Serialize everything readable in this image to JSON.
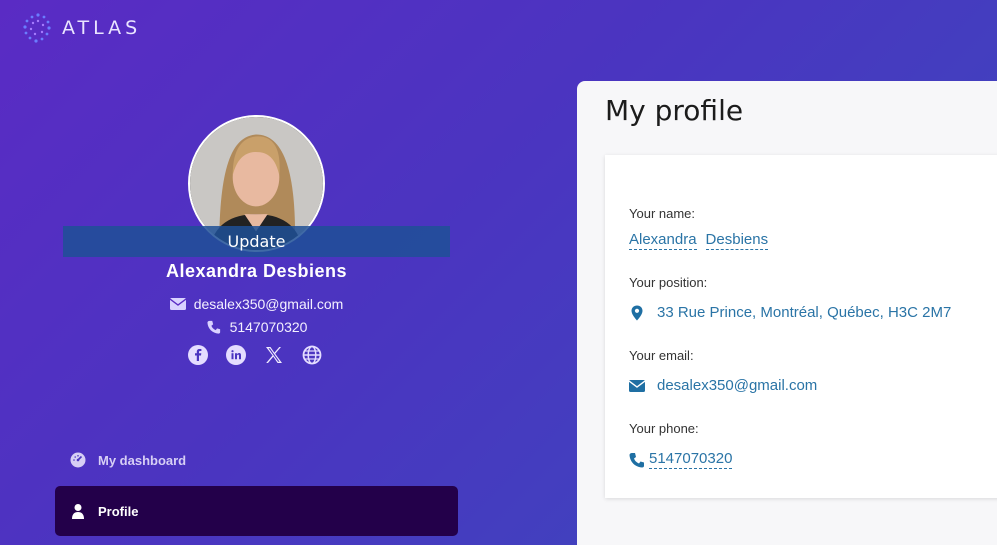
{
  "brand": {
    "name": "ATLAS"
  },
  "profile": {
    "avatar_action": "Update",
    "first_name": "Alexandra",
    "last_name": "Desbiens",
    "full_name": "Alexandra  Desbiens",
    "email": "desalex350@gmail.com",
    "phone": "5147070320",
    "socials": [
      "facebook-icon",
      "linkedin-icon",
      "x-icon",
      "globe-icon"
    ]
  },
  "nav": {
    "items": [
      {
        "label": "My dashboard",
        "icon": "dashboard-gauge-icon",
        "active": false
      },
      {
        "label": "Profile",
        "icon": "user-icon",
        "active": true
      }
    ]
  },
  "main": {
    "title": "My profile",
    "fields": {
      "name_label": "Your name:",
      "position_label": "Your position:",
      "position_value": "33 Rue Prince, Montréal, Québec, H3C 2M7",
      "email_label": "Your email:",
      "email_value": "desalex350@gmail.com",
      "phone_label": "Your phone:",
      "phone_value": "5147070320"
    }
  },
  "colors": {
    "accent": "#2a74a6",
    "active_nav": "#23004a",
    "panel_bg": "#f7f7f9"
  }
}
